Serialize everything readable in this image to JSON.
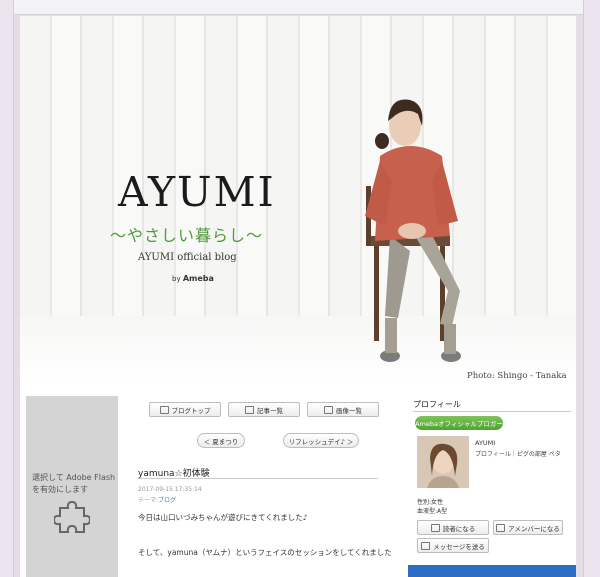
{
  "header": {
    "title": "AYUMI",
    "subtitle": "～やさしい暮らし～",
    "blog_name": "AYUMI official blog",
    "by": "by",
    "brand": "Ameba",
    "photo_credit": "Photo: Shingo - Tanaka"
  },
  "flash": {
    "message": "選択して Adobe Flash を有効にします",
    "icon": "puzzle-icon"
  },
  "nav": {
    "blog_top": "ブログトップ",
    "articles": "記事一覧",
    "images": "画像一覧",
    "prev": "＜ 夏まつり",
    "next": "リフレッシュデイ♪ ＞"
  },
  "post": {
    "title": "yamuna☆初体験",
    "date": "2017-09-15 17:35:14",
    "theme_label": "テーマ:",
    "theme": "ブログ",
    "line1": "今日は山口いづみちゃんが遊びにきてくれました♪",
    "line2": "そして、yamuna（ヤムナ）というフェイスのセッションをしてくれました"
  },
  "profile": {
    "heading": "プロフィール",
    "badge": "Amebaオフィシャルブロガー",
    "name": "AYUMI",
    "description": "プロフィール｜ピグの部屋 ペタ",
    "gender": "性別:女性",
    "blood": "血液型:A型",
    "reader_button": "読者になる",
    "member_button": "アメンバーになる",
    "message_button": "メッセージを送る"
  },
  "colors": {
    "accent_green": "#4f9a3c",
    "badge_green": "#5aad37",
    "flash_gray": "#d4d4d4"
  }
}
